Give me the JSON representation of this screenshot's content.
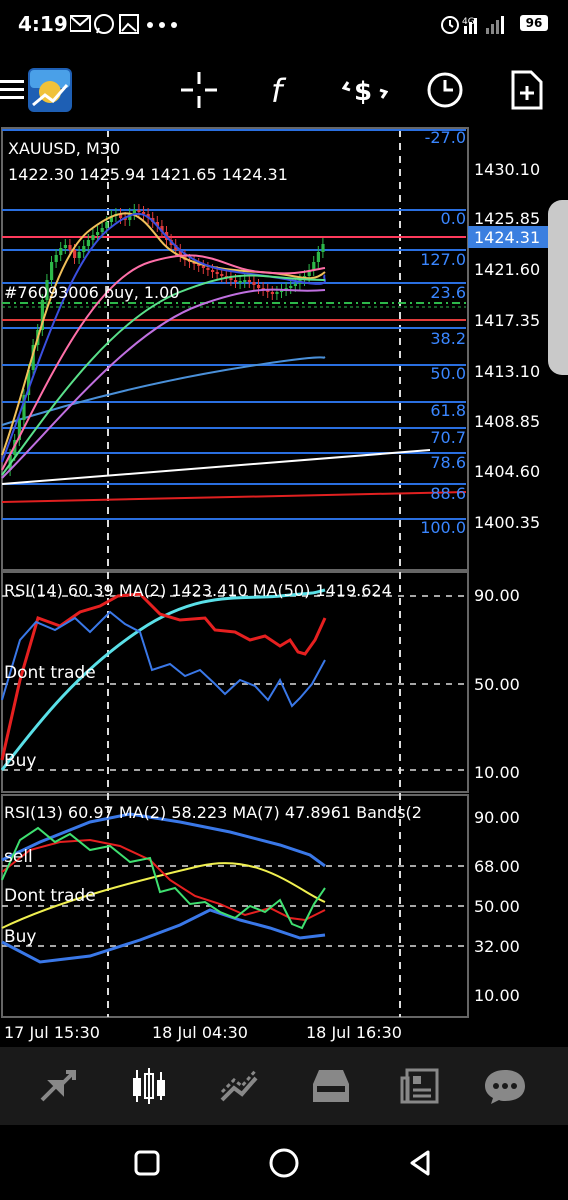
{
  "status_bar": {
    "time": "4:19",
    "battery": "96",
    "icons": [
      "gmail-m-icon",
      "whatsapp-icon",
      "image-icon",
      "more-dots-icon",
      "alarm-icon",
      "4g-icon",
      "signal-icon",
      "signal-icon"
    ]
  },
  "toolbar": {
    "icons": [
      "menu-icon",
      "metatrader-logo-icon",
      "crosshair-icon",
      "indicators-f-icon",
      "objects-dollar-icon",
      "timeframe-clock-icon",
      "add-document-icon"
    ]
  },
  "main_chart": {
    "symbol": "XAUUSD, M30",
    "ohlc": "1422.30 1425.94 1421.65 1424.31",
    "position_label": "#76093006 buy, 1.00",
    "price_labels": [
      "1430.10",
      "1425.85",
      "1421.60",
      "1417.35",
      "1413.10",
      "1408.85",
      "1404.60",
      "1400.35"
    ],
    "current_price": "1424.31",
    "fib_levels": [
      "-27.0",
      "0.0",
      "127.0",
      "23.6",
      "38.2",
      "50.0",
      "61.8",
      "70.7",
      "78.6",
      "88.6",
      "100.0"
    ],
    "colors": {
      "bull": "#2db84a",
      "bear": "#e23b3b",
      "fib": "#2a6fe0",
      "price_box": "#3b7fe0",
      "price_line": "#ff3b5c"
    }
  },
  "rsi_panel_1": {
    "header": "RSI(14) 60.39 MA(2) 1423.410 MA(50) 1419.624",
    "levels": [
      "90.00",
      "50.00",
      "10.00"
    ],
    "labels": [
      "Dont trade",
      "Buy"
    ]
  },
  "rsi_panel_2": {
    "header": "RSI(13) 60.97 MA(2) 58.223 MA(7) 47.8961 Bands(2",
    "levels": [
      "90.00",
      "68.00",
      "50.00",
      "32.00",
      "10.00"
    ],
    "labels": [
      "sell",
      "Dont trade",
      "Buy"
    ]
  },
  "time_axis": [
    "17 Jul 15:30",
    "18 Jul 04:30",
    "18 Jul 16:30"
  ],
  "bottom_nav": {
    "items": [
      "quotes-icon",
      "chart-icon",
      "trade-icon",
      "history-icon",
      "news-icon",
      "messages-icon"
    ],
    "active": "chart-icon"
  },
  "android_nav": [
    "recents-icon",
    "home-icon",
    "back-icon"
  ]
}
